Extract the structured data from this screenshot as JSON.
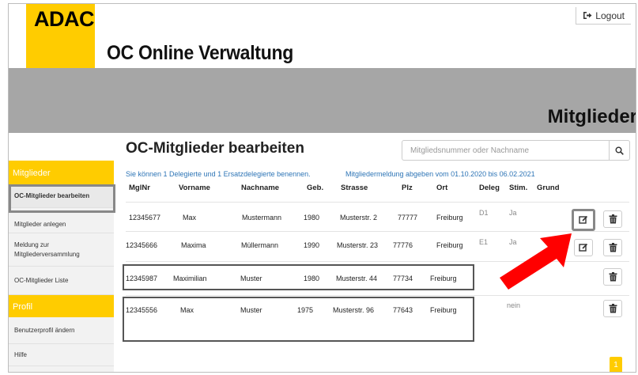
{
  "header": {
    "logo_text": "ADAC",
    "app_title": "OC Online Verwaltung",
    "logout_label": "Logout"
  },
  "page_heading": "Mitglieder",
  "sidebar": {
    "sections": [
      {
        "label": "Mitglieder",
        "items": [
          "OC-Mitglieder bearbeiten",
          "Mitglieder anlegen",
          "Meldung zur Mitgliederversammlung",
          "OC-Mitglieder Liste"
        ]
      },
      {
        "label": "Profil",
        "items": [
          "Benutzerprofil ändern",
          "Hilfe"
        ]
      }
    ]
  },
  "main": {
    "title": "OC-Mitglieder bearbeiten",
    "search_placeholder": "Mitgliedsnummer oder Nachname",
    "info_delegates": "Sie können 1 Delegierte und 1 Ersatzdelegierte benennen.",
    "info_deadline": "Mitgliedermeldung abgeben vom 01.10.2020 bis 06.02.2021",
    "columns": [
      "MglNr",
      "Vorname",
      "Nachname",
      "Geb.",
      "Strasse",
      "Plz",
      "Ort",
      "Deleg",
      "Stim.",
      "Grund"
    ],
    "rows": [
      {
        "mglnr": "12345677",
        "vorname": "Max",
        "nachname": "Mustermann",
        "geb": "1980",
        "strasse": "Musterstr. 2",
        "plz": "77777",
        "ort": "Freiburg",
        "deleg": "D1",
        "stim": "Ja"
      },
      {
        "mglnr": "12345666",
        "vorname": "Maxima",
        "nachname": "Müllermann",
        "geb": "1990",
        "strasse": "Musterstr. 23",
        "plz": "77776",
        "ort": "Freiburg",
        "deleg": "E1",
        "stim": "Ja"
      },
      {
        "mglnr": "12345987",
        "vorname": "Maximilian",
        "nachname": "Muster",
        "geb": "1980",
        "strasse": "Musterstr. 44",
        "plz": "77734",
        "ort": "Freiburg",
        "deleg": "",
        "stim": ""
      },
      {
        "mglnr": "12345556",
        "vorname": "Max",
        "nachname": "Muster",
        "geb": "1975",
        "strasse": "Musterstr. 96",
        "plz": "77643",
        "ort": "Freiburg",
        "deleg": "",
        "stim": "nein"
      }
    ],
    "pagination_current": "1"
  },
  "icons": {
    "edit": "edit-icon",
    "delete": "trash-icon",
    "search": "search-icon",
    "logout": "logout-icon"
  },
  "colors": {
    "brand_yellow": "#ffcc00",
    "header_band": "#a6a6a6",
    "info_blue": "#2e75b6",
    "arrow_red": "#ff0000"
  }
}
